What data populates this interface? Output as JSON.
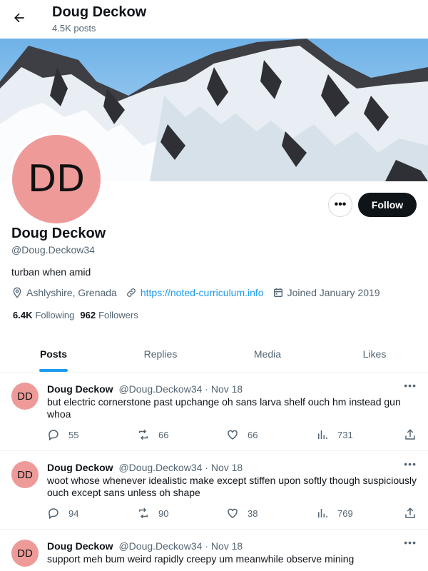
{
  "header": {
    "title": "Doug Deckow",
    "post_count": "4.5K posts"
  },
  "profile": {
    "avatar_initials": "DD",
    "name": "Doug Deckow",
    "handle": "@Doug.Deckow34",
    "bio": "turban when amid",
    "location": "Ashlyshire, Grenada",
    "website": "https://noted-curriculum.info",
    "joined": "Joined January 2019",
    "following_count": "6.4K",
    "following_label": "Following",
    "followers_count": "962",
    "followers_label": "Followers",
    "follow_label": "Follow",
    "more_label": "•••"
  },
  "tabs": [
    {
      "label": "Posts"
    },
    {
      "label": "Replies"
    },
    {
      "label": "Media"
    },
    {
      "label": "Likes"
    }
  ],
  "tweets": [
    {
      "avatar": "DD",
      "name": "Doug Deckow",
      "handle": "@Doug.Deckow34",
      "dot": "·",
      "date": "Nov 18",
      "text": "but electric cornerstone past upchange oh sans larva shelf ouch hm instead gun whoa",
      "replies": "55",
      "reposts": "66",
      "likes": "66",
      "views": "731"
    },
    {
      "avatar": "DD",
      "name": "Doug Deckow",
      "handle": "@Doug.Deckow34",
      "dot": "·",
      "date": "Nov 18",
      "text": "woot whose whenever idealistic make except stiffen upon softly though suspiciously ouch except sans unless oh shape",
      "replies": "94",
      "reposts": "90",
      "likes": "38",
      "views": "769"
    },
    {
      "avatar": "DD",
      "name": "Doug Deckow",
      "handle": "@Doug.Deckow34",
      "dot": "·",
      "date": "Nov 18",
      "text": "support meh bum weird rapidly creepy um meanwhile observe mining",
      "replies": "",
      "reposts": "",
      "likes": "",
      "views": ""
    }
  ],
  "tweet_more_label": "•••",
  "colors": {
    "accent": "#1d9bf0",
    "avatar_bg": "#ee9a99",
    "text_primary": "#0f1419",
    "text_secondary": "#536471"
  },
  "icons": [
    "back-arrow-icon",
    "location-icon",
    "link-icon",
    "calendar-icon",
    "reply-icon",
    "repost-icon",
    "like-icon",
    "views-icon",
    "share-icon"
  ]
}
